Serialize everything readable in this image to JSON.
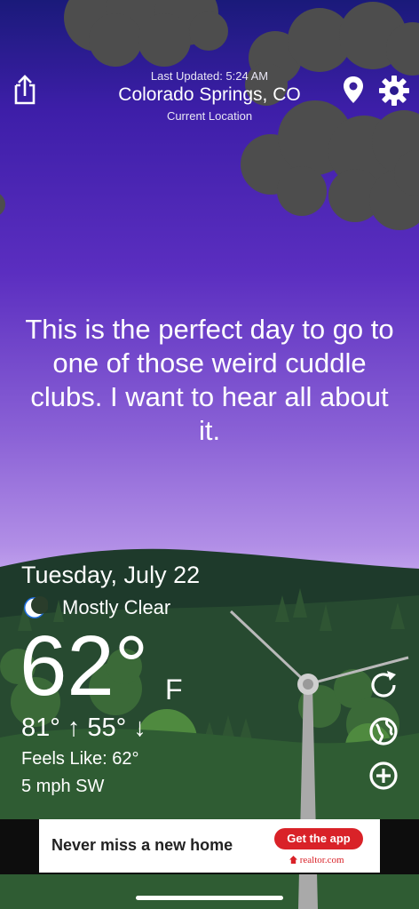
{
  "header": {
    "last_updated": "Last Updated: 5:24 AM",
    "city": "Colorado Springs, CO",
    "subtitle": "Current Location",
    "icons": [
      "share-icon",
      "location-pin-icon",
      "gear-icon"
    ]
  },
  "message": "This is the perfect day to go to one of those weird cuddle clubs. I want to hear all about it.",
  "weather": {
    "date": "Tuesday, July 22",
    "condition_icon": "crescent-moon-icon",
    "condition": "Mostly Clear",
    "temperature": "62°",
    "unit": "F",
    "high": "81° ↑",
    "low": "55° ↓",
    "feels_like": "Feels Like: 62°",
    "wind": "5 mph SW"
  },
  "side_actions": [
    "refresh-icon",
    "globe-icon",
    "add-circle-icon"
  ],
  "ad": {
    "headline": "Never miss a new home",
    "cta": "Get the app",
    "brand": "realtor.com",
    "cta_color": "#d92228"
  },
  "colors": {
    "sky_top": "#1a1a7a",
    "sky_mid": "#5b2ec0",
    "sky_bottom": "#c6a8ef",
    "cloud": "#4d4d4d",
    "hill_dark": "#1f3a2a",
    "grass": "#2f5c33"
  }
}
